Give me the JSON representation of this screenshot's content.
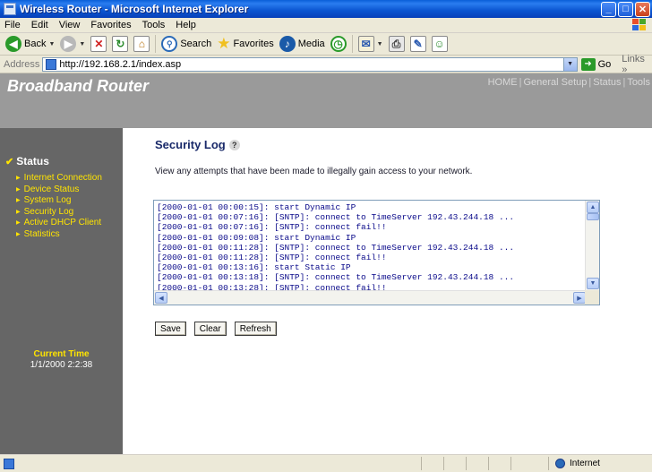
{
  "window": {
    "title": "Wireless Router - Microsoft Internet Explorer"
  },
  "menu": [
    "File",
    "Edit",
    "View",
    "Favorites",
    "Tools",
    "Help"
  ],
  "toolbar": {
    "back": "Back",
    "search": "Search",
    "favorites": "Favorites",
    "media": "Media"
  },
  "address": {
    "label": "Address",
    "url": "http://192.168.2.1/index.asp",
    "go": "Go",
    "links": "Links"
  },
  "router": {
    "brand": "Broadband Router",
    "topnav": [
      "HOME",
      "General Setup",
      "Status",
      "Tools"
    ]
  },
  "sidebar": {
    "section": "Status",
    "items": [
      "Internet Connection",
      "Device Status",
      "System Log",
      "Security Log",
      "Active DHCP Client",
      "Statistics"
    ],
    "time_label": "Current Time",
    "time_value": "1/1/2000 2:2:38"
  },
  "main": {
    "title": "Security Log",
    "description": "View any attempts that have been made to illegally gain access to your network.",
    "log_lines": [
      "[2000-01-01 00:00:15]: start Dynamic IP",
      "[2000-01-01 00:07:16]: [SNTP]: connect to TimeServer 192.43.244.18 ...",
      "[2000-01-01 00:07:16]: [SNTP]: connect fail!!",
      "[2000-01-01 00:09:08]: start Dynamic IP",
      "[2000-01-01 00:11:28]: [SNTP]: connect to TimeServer 192.43.244.18 ...",
      "[2000-01-01 00:11:28]: [SNTP]: connect fail!!",
      "[2000-01-01 00:13:16]: start Static IP",
      "[2000-01-01 00:13:18]: [SNTP]: connect to TimeServer 192.43.244.18 ...",
      "[2000-01-01 00:13:28]: [SNTP]: connect fail!!"
    ],
    "buttons": {
      "save": "Save",
      "clear": "Clear",
      "refresh": "Refresh"
    }
  },
  "status": {
    "zone": "Internet"
  },
  "colors": {
    "sidebar_bg": "#666666",
    "sidebar_link": "#ffe400",
    "header_bg": "#9a9a9a",
    "title": "#1a2a6a",
    "log_text": "#0a0a8a"
  }
}
